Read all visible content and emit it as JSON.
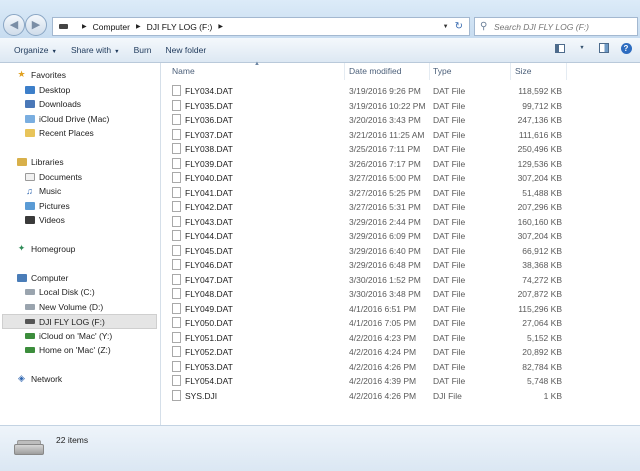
{
  "window": {
    "address": {
      "root": "Computer",
      "current": "DJI FLY LOG (F:)"
    },
    "search_placeholder": "Search DJI FLY LOG (F:)"
  },
  "toolbar": {
    "organize": "Organize",
    "share_with": "Share with",
    "burn": "Burn",
    "new_folder": "New folder"
  },
  "nav": {
    "favorites": "Favorites",
    "desktop": "Desktop",
    "downloads": "Downloads",
    "icloud_drive": "iCloud Drive (Mac)",
    "recent_places": "Recent Places",
    "libraries": "Libraries",
    "documents": "Documents",
    "music": "Music",
    "pictures": "Pictures",
    "videos": "Videos",
    "homegroup": "Homegroup",
    "computer": "Computer",
    "local_disk": "Local Disk (C:)",
    "new_volume": "New Volume (D:)",
    "dji_fly_log": "DJI FLY LOG (F:)",
    "icloud_mac": "iCloud on 'Mac' (Y:)",
    "home_mac": "Home on 'Mac' (Z:)",
    "network": "Network"
  },
  "columns": {
    "name": "Name",
    "date_modified": "Date modified",
    "type": "Type",
    "size": "Size"
  },
  "files": [
    {
      "name": "FLY034.DAT",
      "date": "3/19/2016 9:26 PM",
      "type": "DAT File",
      "size": "118,592 KB"
    },
    {
      "name": "FLY035.DAT",
      "date": "3/19/2016 10:22 PM",
      "type": "DAT File",
      "size": "99,712 KB"
    },
    {
      "name": "FLY036.DAT",
      "date": "3/20/2016 3:43 PM",
      "type": "DAT File",
      "size": "247,136 KB"
    },
    {
      "name": "FLY037.DAT",
      "date": "3/21/2016 11:25 AM",
      "type": "DAT File",
      "size": "111,616 KB"
    },
    {
      "name": "FLY038.DAT",
      "date": "3/25/2016 7:11 PM",
      "type": "DAT File",
      "size": "250,496 KB"
    },
    {
      "name": "FLY039.DAT",
      "date": "3/26/2016 7:17 PM",
      "type": "DAT File",
      "size": "129,536 KB"
    },
    {
      "name": "FLY040.DAT",
      "date": "3/27/2016 5:00 PM",
      "type": "DAT File",
      "size": "307,204 KB"
    },
    {
      "name": "FLY041.DAT",
      "date": "3/27/2016 5:25 PM",
      "type": "DAT File",
      "size": "51,488 KB"
    },
    {
      "name": "FLY042.DAT",
      "date": "3/27/2016 5:31 PM",
      "type": "DAT File",
      "size": "207,296 KB"
    },
    {
      "name": "FLY043.DAT",
      "date": "3/29/2016 2:44 PM",
      "type": "DAT File",
      "size": "160,160 KB"
    },
    {
      "name": "FLY044.DAT",
      "date": "3/29/2016 6:09 PM",
      "type": "DAT File",
      "size": "307,204 KB"
    },
    {
      "name": "FLY045.DAT",
      "date": "3/29/2016 6:40 PM",
      "type": "DAT File",
      "size": "66,912 KB"
    },
    {
      "name": "FLY046.DAT",
      "date": "3/29/2016 6:48 PM",
      "type": "DAT File",
      "size": "38,368 KB"
    },
    {
      "name": "FLY047.DAT",
      "date": "3/30/2016 1:52 PM",
      "type": "DAT File",
      "size": "74,272 KB"
    },
    {
      "name": "FLY048.DAT",
      "date": "3/30/2016 3:48 PM",
      "type": "DAT File",
      "size": "207,872 KB"
    },
    {
      "name": "FLY049.DAT",
      "date": "4/1/2016 6:51 PM",
      "type": "DAT File",
      "size": "115,296 KB"
    },
    {
      "name": "FLY050.DAT",
      "date": "4/1/2016 7:05 PM",
      "type": "DAT File",
      "size": "27,064 KB"
    },
    {
      "name": "FLY051.DAT",
      "date": "4/2/2016 4:23 PM",
      "type": "DAT File",
      "size": "5,152 KB"
    },
    {
      "name": "FLY052.DAT",
      "date": "4/2/2016 4:24 PM",
      "type": "DAT File",
      "size": "20,892 KB"
    },
    {
      "name": "FLY053.DAT",
      "date": "4/2/2016 4:26 PM",
      "type": "DAT File",
      "size": "82,784 KB"
    },
    {
      "name": "FLY054.DAT",
      "date": "4/2/2016 4:39 PM",
      "type": "DAT File",
      "size": "5,748 KB"
    },
    {
      "name": "SYS.DJI",
      "date": "4/2/2016 4:26 PM",
      "type": "DJI File",
      "size": "1 KB"
    }
  ],
  "status": {
    "item_count": "22 items"
  },
  "colors": {
    "accent": "#3b6db2",
    "folder": "#e8c45a",
    "selected_bg": "#e5e5e5"
  }
}
